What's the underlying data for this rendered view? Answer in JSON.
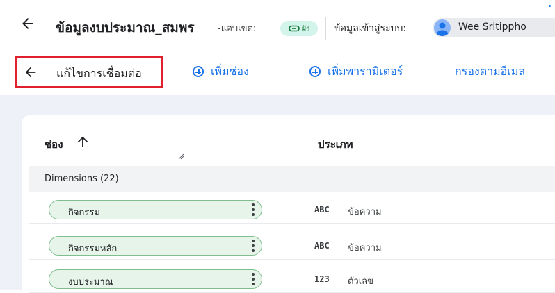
{
  "header": {
    "title": "ข้อมูลงบประมาณ_สมพร",
    "subtitle": "-แอบเขต:",
    "embed_chip": "ฝัง",
    "login_label": "ข้อมูลเข้าสู่ระบบ:",
    "user_name": "Wee Sritippho"
  },
  "toolbar": {
    "edit_connection": "แก้ไขการเชื่อมต่อ",
    "add_field": "เพิ่มช่อง",
    "add_parameter": "เพิ่มพารามิเตอร์",
    "filter_by_email": "กรองตามอีเมล"
  },
  "table": {
    "col_field": "ช่อง",
    "col_type": "ประเภท",
    "dimensions_header": "Dimensions (22)",
    "rows": [
      {
        "field": "กิจกรรม",
        "type_icon": "ABC",
        "type": "ข้อความ"
      },
      {
        "field": "กิจกรรมหลัก",
        "type_icon": "ABC",
        "type": "ข้อความ"
      },
      {
        "field": "งบประมาณ",
        "type_icon": "123",
        "type": "ตัวเลข"
      }
    ]
  },
  "colors": {
    "accent": "#1a73e8",
    "highlight_box": "#e0202d",
    "field_pill": "#e6f4ea",
    "content_bg": "#eef1f7"
  },
  "icons": {
    "back": "arrow-left-icon",
    "add": "plus-circle-icon",
    "sort": "arrow-up-icon",
    "more": "kebab-vertical-icon",
    "embed": "link-icon",
    "avatar": "user-avatar-icon"
  }
}
